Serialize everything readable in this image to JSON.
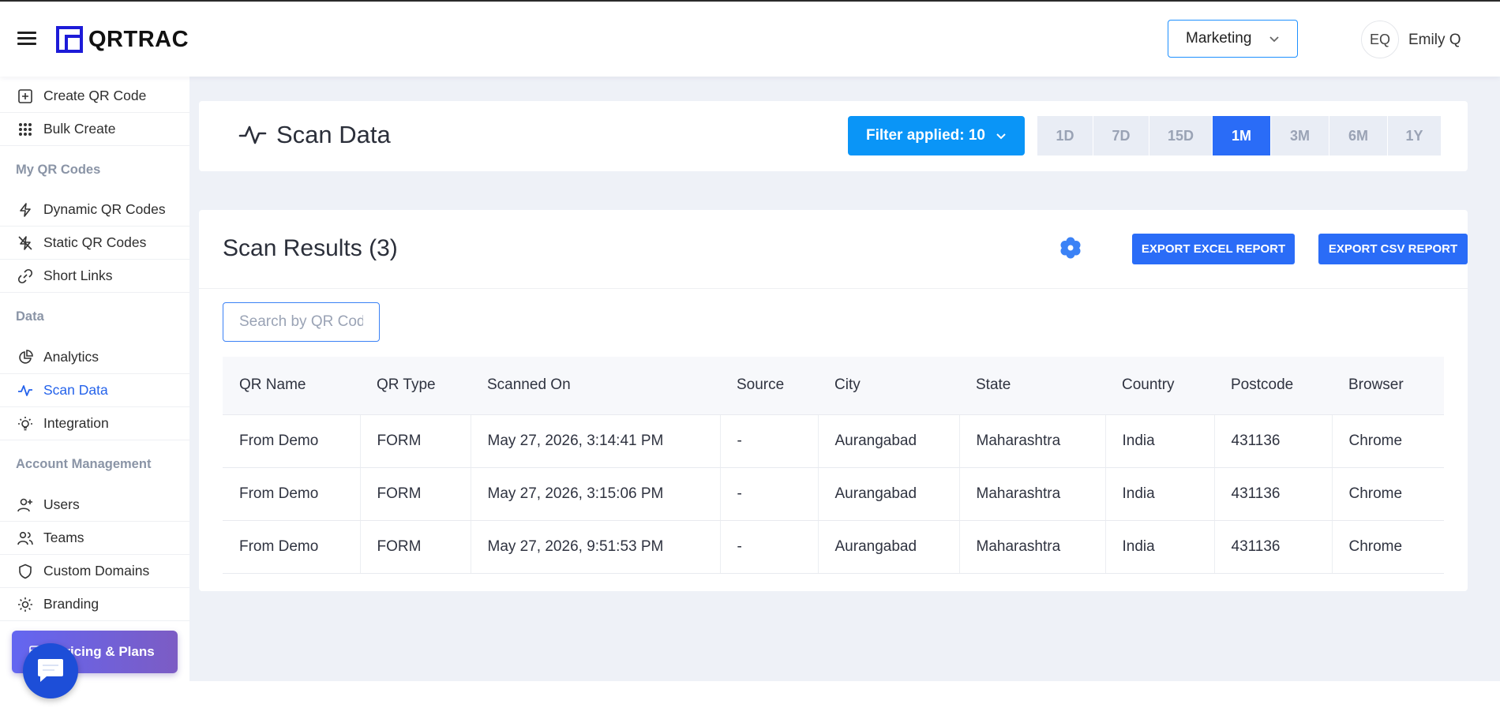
{
  "app": {
    "name": "QRTRAC"
  },
  "header": {
    "org_select": "Marketing",
    "user_initials": "EQ",
    "user_name": "Emily Q"
  },
  "sidebar": {
    "items": [
      {
        "label": "Create QR Code",
        "icon": "plus-square-icon"
      },
      {
        "label": "Bulk Create",
        "icon": "grid-dots-icon"
      },
      {
        "label": "Dynamic QR Codes",
        "icon": "lightning-icon"
      },
      {
        "label": "Static QR Codes",
        "icon": "lightning-off-icon"
      },
      {
        "label": "Short Links",
        "icon": "link-icon"
      },
      {
        "label": "Analytics",
        "icon": "pie-chart-icon"
      },
      {
        "label": "Scan Data",
        "icon": "activity-icon",
        "active": true
      },
      {
        "label": "Integration",
        "icon": "lightbulb-icon"
      },
      {
        "label": "Users",
        "icon": "user-plus-icon"
      },
      {
        "label": "Teams",
        "icon": "users-icon"
      },
      {
        "label": "Custom Domains",
        "icon": "shield-icon"
      },
      {
        "label": "Branding",
        "icon": "sun-icon"
      }
    ],
    "sections": [
      "My QR Codes",
      "Data",
      "Account Management"
    ],
    "pricing_label": "Pricing & Plans"
  },
  "page": {
    "title": "Scan Data",
    "filter_label": "Filter applied: 10",
    "ranges": [
      "1D",
      "7D",
      "15D",
      "1M",
      "3M",
      "6M",
      "1Y"
    ],
    "active_range": "1M"
  },
  "results": {
    "title": "Scan Results (3)",
    "export_excel": "EXPORT EXCEL REPORT",
    "export_csv": "EXPORT CSV REPORT",
    "search_placeholder": "Search by QR Code",
    "columns": [
      "QR Name",
      "QR Type",
      "Scanned On",
      "Source",
      "City",
      "State",
      "Country",
      "Postcode",
      "Browser"
    ],
    "rows": [
      [
        "From Demo",
        "FORM",
        "May 27, 2026, 3:14:41 PM",
        "-",
        "Aurangabad",
        "Maharashtra",
        "India",
        "431136",
        "Chrome"
      ],
      [
        "From Demo",
        "FORM",
        "May 27, 2026, 3:15:06 PM",
        "-",
        "Aurangabad",
        "Maharashtra",
        "India",
        "431136",
        "Chrome"
      ],
      [
        "From Demo",
        "FORM",
        "May 27, 2026, 9:51:53 PM",
        "-",
        "Aurangabad",
        "Maharashtra",
        "India",
        "431136",
        "Chrome"
      ]
    ]
  },
  "colors": {
    "accent": "#2a6cf7",
    "filter": "#0a95f7",
    "background": "#eef1f7"
  }
}
